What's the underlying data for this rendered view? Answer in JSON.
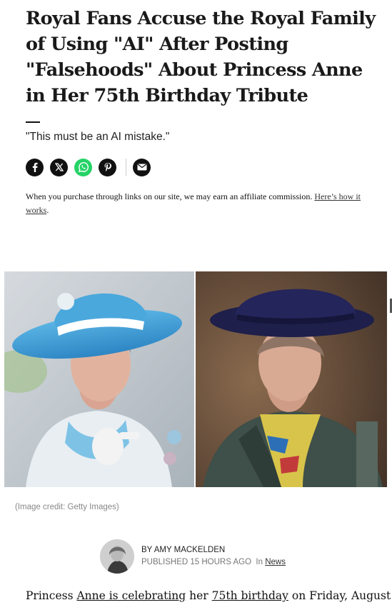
{
  "article": {
    "headline": "Royal Fans Accuse the Royal Family of Using \"AI\" After Posting \"Falsehoods\" About Princess Anne in Her 75th Birthday Tribute",
    "subheadline": "\"This must be an AI mistake.\"",
    "image_credit": "(Image credit: Getty Images)"
  },
  "share": {
    "buttons": [
      {
        "icon": "facebook-icon",
        "color": "#111111"
      },
      {
        "icon": "x-icon",
        "color": "#111111"
      },
      {
        "icon": "whatsapp-icon",
        "color": "#25d366"
      },
      {
        "icon": "pinterest-icon",
        "color": "#111111"
      },
      {
        "icon": "email-icon",
        "color": "#111111"
      }
    ]
  },
  "affiliate": {
    "text": "When you purchase through links on our site, we may earn an affiliate commission.",
    "link_text": "Here’s how it works",
    "end": "."
  },
  "byline": {
    "by": "BY",
    "author": "AMY MACKELDEN",
    "published_label": "PUBLISHED",
    "published_time": "15 HOURS AGO",
    "in_label": "In",
    "category": "News"
  },
  "body": {
    "part1": "Princess ",
    "link1": "Anne is celebrating",
    "part2": " her ",
    "link2": "75th birthday",
    "part3": " on Friday, August"
  }
}
